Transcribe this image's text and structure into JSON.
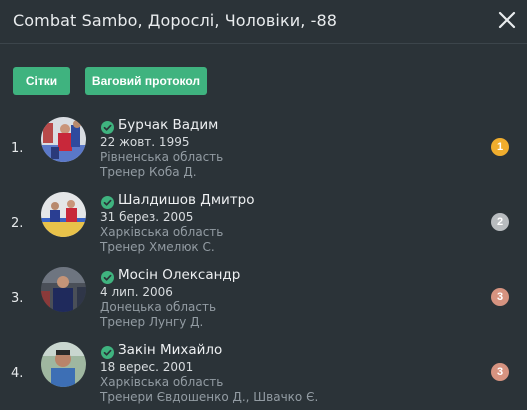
{
  "header": {
    "title": "Combat Sambo, Дорослі, Чоловіки, -88"
  },
  "buttons": {
    "grids": "Сітки",
    "weigh": "Ваговий протокол"
  },
  "athletes": [
    {
      "place": "1.",
      "name": "Бурчак Вадим",
      "birthdate": "22 жовт. 1995",
      "region": "Рівненська область",
      "coach": "Тренер Коба Д.",
      "medal": "1",
      "medal_color": "#f0ad2e"
    },
    {
      "place": "2.",
      "name": "Шалдишов Дмитро",
      "birthdate": "31 берез. 2005",
      "region": "Харківська область",
      "coach": "Тренер Хмелюк С.",
      "medal": "2",
      "medal_color": "#b8bcbf"
    },
    {
      "place": "3.",
      "name": "Мосін Олександр",
      "birthdate": "4 лип. 2006",
      "region": "Донецька область",
      "coach": "Тренер Лунгу Д.",
      "medal": "3",
      "medal_color": "#d69380"
    },
    {
      "place": "4.",
      "name": "Закін Михайло",
      "birthdate": "18 верес. 2001",
      "region": "Харківська область",
      "coach": "Тренери Євдошенко Д.,  Швачко Є.",
      "medal": "3",
      "medal_color": "#d69380"
    }
  ],
  "icons": {
    "close": "close-icon",
    "verified": "check-circle-icon"
  },
  "colors": {
    "accent": "#3fb37f",
    "background": "#2b3338"
  }
}
